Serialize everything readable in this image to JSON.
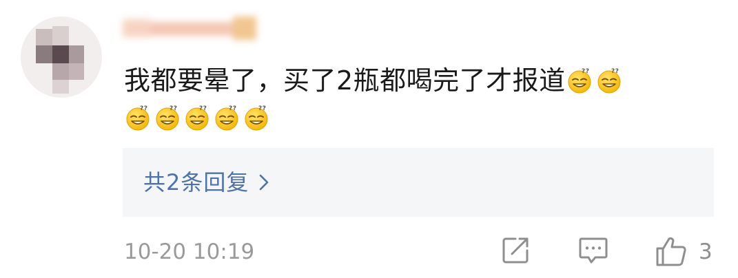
{
  "comment": {
    "text": "我都要晕了，买了2瓶都喝完了才报道",
    "emoji_name": "dizzy-face-emoji",
    "emoji_count_line1": 2,
    "emoji_count_line2": 5
  },
  "replies": {
    "label": "共2条回复"
  },
  "meta": {
    "timestamp": "10-20 10:19",
    "like_count": "3"
  },
  "icons": {
    "repost": "repost-icon",
    "comment": "comment-icon",
    "like": "thumbs-up-icon",
    "chevron": "chevron-right-icon"
  },
  "colors": {
    "link": "#4c72a8",
    "reply_bg": "#f5f6f8",
    "meta_text": "#9a9a9a",
    "icon": "#8e8e8e"
  }
}
